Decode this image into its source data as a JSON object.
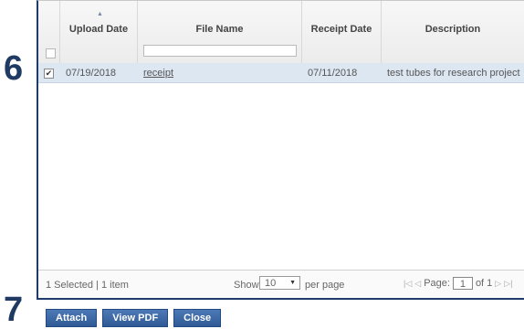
{
  "steps": {
    "six": "6",
    "seven": "7"
  },
  "grid": {
    "sort_indicator": "▲",
    "columns": [
      {
        "label": ""
      },
      {
        "label": "Upload Date"
      },
      {
        "label": "File Name"
      },
      {
        "label": "Receipt Date"
      },
      {
        "label": "Description"
      }
    ],
    "file_name_filter": "",
    "rows": [
      {
        "checked": "✔",
        "upload_date": "07/19/2018",
        "file_name": "receipt",
        "receipt_date": "07/11/2018",
        "description": "test tubes for research project"
      }
    ]
  },
  "footer": {
    "selection": "1 Selected | 1 item",
    "show": "Show",
    "page_size": "10",
    "per_page": "per page",
    "page_label": "Page:",
    "page_value": "1",
    "of_pages": "of 1"
  },
  "buttons": {
    "attach": "Attach",
    "view_pdf": "View PDF",
    "close": "Close"
  },
  "colors": {
    "button": "#2f5a96",
    "selected_row": "#dde7f2",
    "step_number": "#1f3a63"
  }
}
